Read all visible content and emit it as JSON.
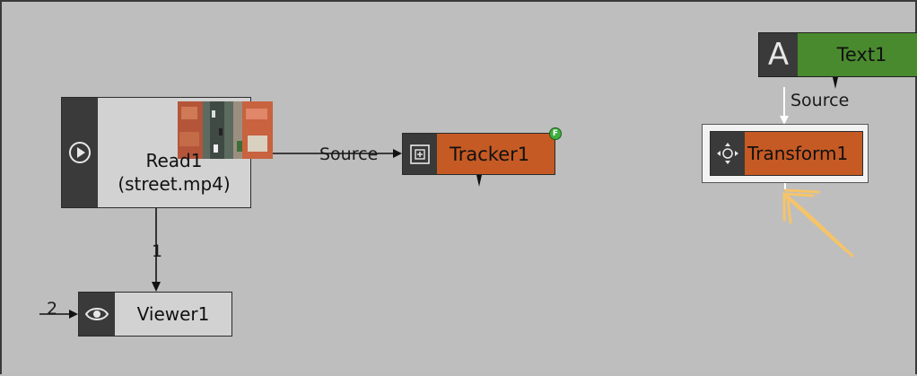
{
  "nodes": {
    "read": {
      "name": "Read1",
      "file": "(street.mp4)",
      "icon": "play-icon"
    },
    "tracker": {
      "name": "Tracker1",
      "icon": "tracker-icon",
      "badge": "F"
    },
    "viewer": {
      "name": "Viewer1",
      "icon": "eye-icon"
    },
    "text": {
      "name": "Text1",
      "icon_glyph": "A",
      "icon": "text-a-icon"
    },
    "transform": {
      "name": "Transform1",
      "icon": "move-arrows-icon",
      "selected": true
    }
  },
  "wires": {
    "read_to_tracker_label": "Source",
    "text_to_transform_label": "Source",
    "read_to_viewer_label": "1",
    "viewer_input_label": "2"
  },
  "colors": {
    "canvas": "#bebebe",
    "orange_node": "#c55a24",
    "green_node": "#4a8a2f",
    "gray_node": "#d2d2d2",
    "icon_box": "#3a3a3a",
    "annotation": "#f5c46a"
  }
}
